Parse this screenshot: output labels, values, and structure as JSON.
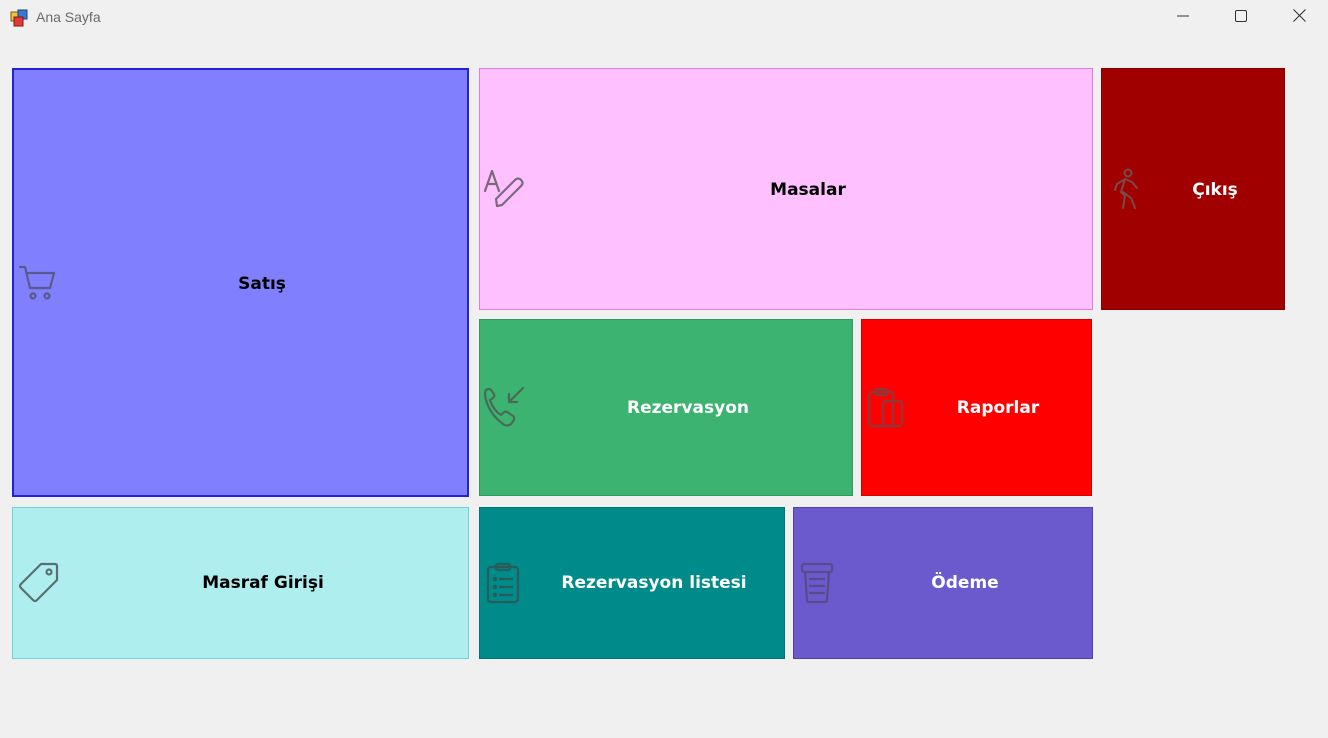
{
  "window": {
    "title": "Ana Sayfa",
    "controls": {
      "minimize": "minimize-icon",
      "maximize": "maximize-icon",
      "close": "close-icon"
    }
  },
  "tiles": {
    "satis": {
      "label": "Satış",
      "icon": "cart-icon",
      "color": "#8080ff"
    },
    "masalar": {
      "label": "Masalar",
      "icon": "pen-text-icon",
      "color": "#ffc0ff"
    },
    "cikis": {
      "label": "Çıkış",
      "icon": "walking-person-icon",
      "color": "#a10000"
    },
    "rezervasyon": {
      "label": "Rezervasyon",
      "icon": "phone-incoming-icon",
      "color": "#3cb371"
    },
    "raporlar": {
      "label": "Raporlar",
      "icon": "clipboard-icon",
      "color": "#ff0000"
    },
    "masraf": {
      "label": "Masraf Girişi",
      "icon": "tag-icon",
      "color": "#afeeee"
    },
    "rezervasyon_listesi": {
      "label": "Rezervasyon listesi",
      "icon": "clipboard-list-icon",
      "color": "#008b8b"
    },
    "odeme": {
      "label": "Ödeme",
      "icon": "trash-icon",
      "color": "#6a5acd"
    }
  }
}
